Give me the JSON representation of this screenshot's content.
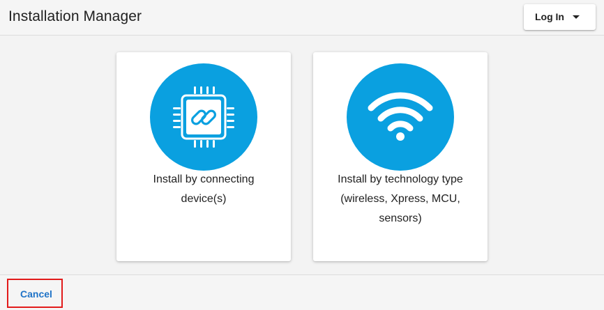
{
  "header": {
    "title": "Installation Manager",
    "login_label": "Log In",
    "login_icon": "caret-down-icon"
  },
  "cards": [
    {
      "icon": "chip-link-icon",
      "label_lines": [
        "Install by connecting",
        "device(s)"
      ]
    },
    {
      "icon": "wifi-icon",
      "label_lines": [
        "Install by technology type",
        "(wireless, Xpress, MCU,",
        "sensors)"
      ]
    }
  ],
  "footer": {
    "cancel_label": "Cancel"
  },
  "colors": {
    "accent": "#0aa0e0",
    "link": "#1f73c7",
    "highlight_border": "#e21b1b"
  }
}
